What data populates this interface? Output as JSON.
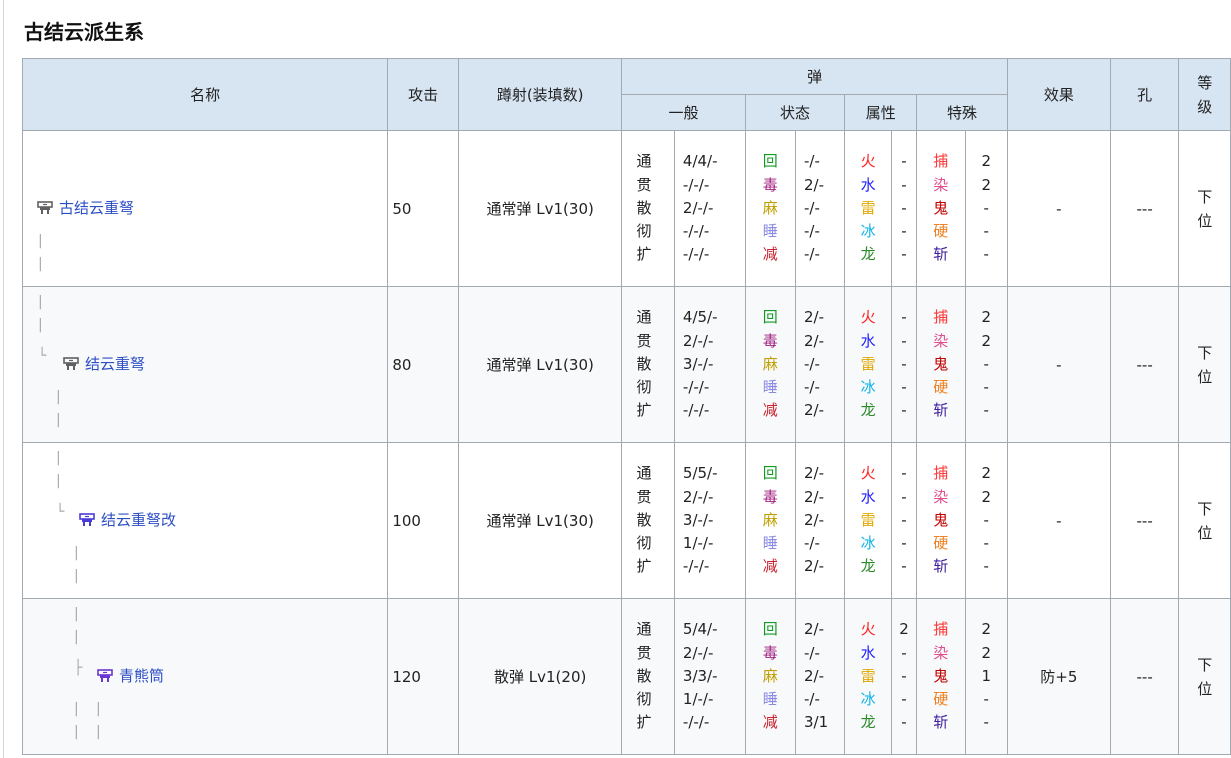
{
  "page": {
    "section_title": "古结云派生系"
  },
  "headers": {
    "name": "名称",
    "attack": "攻击",
    "recoil": "蹲射(装填数)",
    "ammo": "弹",
    "effect": "效果",
    "slots": "孔",
    "rank": "等级",
    "sub_general": "一般",
    "sub_status": "状态",
    "sub_element": "属性",
    "sub_special": "特殊"
  },
  "labels": {
    "general": [
      "通",
      "贯",
      "散",
      "彻",
      "扩"
    ],
    "status": [
      "回",
      "毒",
      "麻",
      "睡",
      "减"
    ],
    "element": [
      "火",
      "水",
      "雷",
      "冰",
      "龙"
    ],
    "special": [
      "捕",
      "染",
      "鬼",
      "硬",
      "斩"
    ]
  },
  "colors": {
    "link": "#2d4fc6",
    "header_bg": "#d7e4f1",
    "border": "#a2a9b1",
    "icon_rare1": "#606060",
    "icon_rare3": "#4b3bd6",
    "icon_rare3b": "#6a35d0"
  },
  "weapons": [
    {
      "name": "古结云重弩",
      "icon": "heavy-bowgun-icon",
      "icon_color": "#606060",
      "attack": "50",
      "recoil": "通常弹 Lv1(30)",
      "general": [
        "4/4/-",
        "-/-/-",
        "2/-/-",
        "-/-/-",
        "-/-/-"
      ],
      "status": [
        "-/-",
        "2/-",
        "-/-",
        "-/-",
        "-/-"
      ],
      "element": [
        "-",
        "-",
        "-",
        "-",
        "-"
      ],
      "special": [
        "2",
        "2",
        "-",
        "-",
        "-"
      ],
      "effect": "-",
      "slots": "---",
      "rank": "下位"
    },
    {
      "name": "结云重弩",
      "icon": "heavy-bowgun-icon",
      "icon_color": "#606060",
      "attack": "80",
      "recoil": "通常弹 Lv1(30)",
      "general": [
        "4/5/-",
        "2/-/-",
        "3/-/-",
        "-/-/-",
        "-/-/-"
      ],
      "status": [
        "2/-",
        "2/-",
        "-/-",
        "-/-",
        "2/-"
      ],
      "element": [
        "-",
        "-",
        "-",
        "-",
        "-"
      ],
      "special": [
        "2",
        "2",
        "-",
        "-",
        "-"
      ],
      "effect": "-",
      "slots": "---",
      "rank": "下位"
    },
    {
      "name": "结云重弩改",
      "icon": "heavy-bowgun-icon",
      "icon_color": "#4b3bd6",
      "attack": "100",
      "recoil": "通常弹 Lv1(30)",
      "general": [
        "5/5/-",
        "2/-/-",
        "3/-/-",
        "1/-/-",
        "-/-/-"
      ],
      "status": [
        "2/-",
        "2/-",
        "2/-",
        "-/-",
        "2/-"
      ],
      "element": [
        "-",
        "-",
        "-",
        "-",
        "-"
      ],
      "special": [
        "2",
        "2",
        "-",
        "-",
        "-"
      ],
      "effect": "-",
      "slots": "---",
      "rank": "下位"
    },
    {
      "name": "青熊筒",
      "icon": "heavy-bowgun-icon",
      "icon_color": "#6a35d0",
      "attack": "120",
      "recoil": "散弹 Lv1(20)",
      "general": [
        "5/4/-",
        "2/-/-",
        "3/3/-",
        "1/-/-",
        "-/-/-"
      ],
      "status": [
        "2/-",
        "-/-",
        "2/-",
        "-/-",
        "3/1"
      ],
      "element": [
        "2",
        "-",
        "-",
        "-",
        "-"
      ],
      "special": [
        "2",
        "2",
        "1",
        "-",
        "-"
      ],
      "effect": "防+5",
      "slots": "---",
      "rank": "下位"
    }
  ]
}
